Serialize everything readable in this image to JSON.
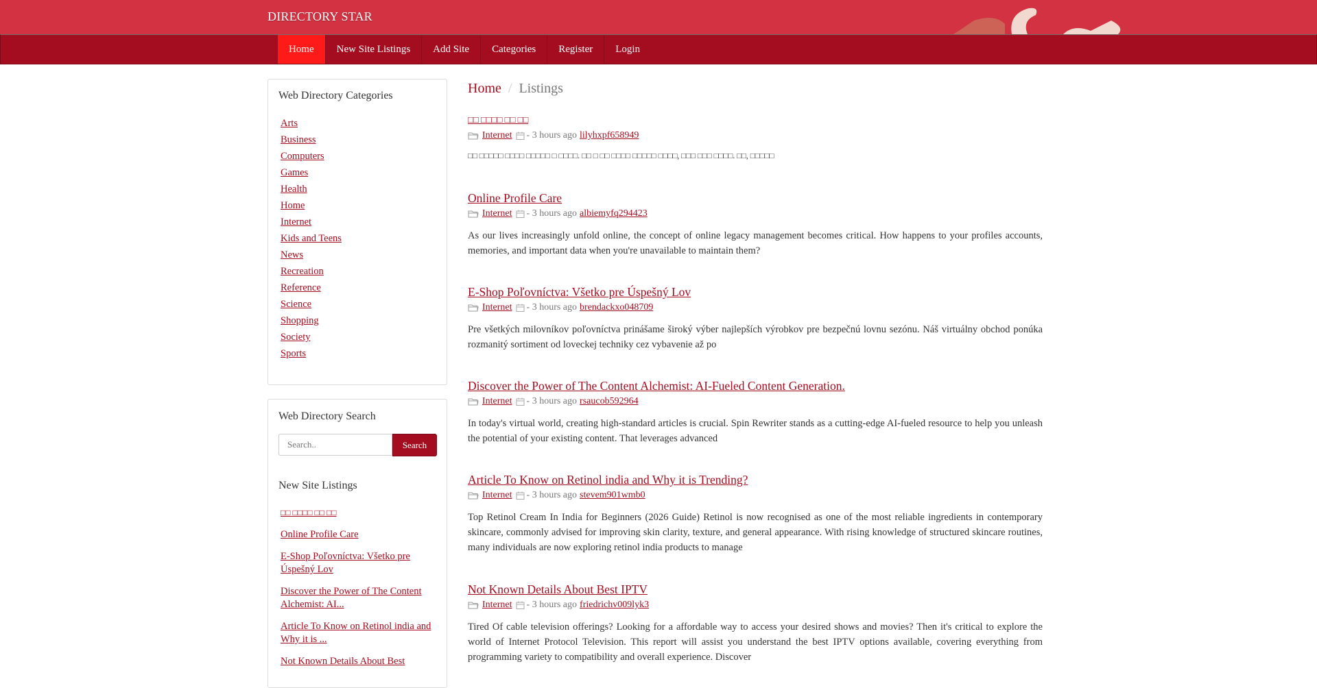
{
  "header": {
    "brand": "DIRECTORY STAR"
  },
  "nav": {
    "items": [
      {
        "label": "Home"
      },
      {
        "label": "New Site Listings"
      },
      {
        "label": "Add Site"
      },
      {
        "label": "Categories"
      },
      {
        "label": "Register"
      },
      {
        "label": "Login"
      }
    ]
  },
  "sidebar": {
    "categories_title": "Web Directory Categories",
    "categories": [
      "Arts",
      "Business",
      "Computers",
      "Games",
      "Health",
      "Home",
      "Internet",
      "Kids and Teens",
      "News",
      "Recreation",
      "Reference",
      "Science",
      "Shopping",
      "Society",
      "Sports"
    ],
    "search_title": "Web Directory Search",
    "search_placeholder": "Search..",
    "search_button": "Search",
    "new_listings_title": "New Site Listings",
    "new_listings": [
      "□□ □□□□ □□ □□",
      "Online Profile Care",
      "E-Shop Poľovníctva: Všetko pre Úspešný Lov",
      "Discover the Power of The Content Alchemist: AI...",
      "Article To Know on Retinol india and Why it is ...",
      "Not Known Details About Best"
    ]
  },
  "breadcrumb": {
    "home": "Home",
    "separator": "/",
    "current": "Listings"
  },
  "listings": [
    {
      "title": "□□ □□□□ □□ □□",
      "category": "Internet",
      "time": "- 3 hours ago",
      "user": "lilyhxpf658949",
      "desc": "□□ □□□□□ □□□□ □□□□□ □ □□□□. □□ □ □□ □□□□ □□□□□ □□□□, □□□ □□□ □□□□. □□, □□□□□"
    },
    {
      "title": "Online Profile Care",
      "category": "Internet",
      "time": "- 3 hours ago",
      "user": "albiemyfq294423",
      "desc": "As our lives increasingly unfold online, the concept of online legacy management becomes critical. How happens to your profiles accounts, memories, and important data when you're unavailable to maintain them?"
    },
    {
      "title": "E-Shop Poľovníctva: Všetko pre Úspešný Lov",
      "category": "Internet",
      "time": "- 3 hours ago",
      "user": "brendackxo048709",
      "desc": "Pre všetkých milovníkov poľovníctva prinášame široký výber najlepších výrobkov pre bezpečnú lovnu sezónu. Náš virtuálny obchod ponúka rozmanitý sortiment od loveckej techniky cez vybavenie až po"
    },
    {
      "title": "Discover the Power of The Content Alchemist: AI-Fueled Content Generation.",
      "category": "Internet",
      "time": "- 3 hours ago",
      "user": "rsaucob592964",
      "desc": "In today's virtual world, creating high-standard articles is crucial. Spin Rewriter stands as a cutting-edge AI-fueled resource to help you unleash the potential of your existing content. That leverages advanced"
    },
    {
      "title": "Article To Know on Retinol india and Why it is Trending?",
      "category": "Internet",
      "time": "- 3 hours ago",
      "user": "stevem901wmb0",
      "desc": "Top Retinol Cream In India for Beginners (2026 Guide) Retinol is now recognised as one of the most reliable ingredients in contemporary skincare, commonly advised for improving skin clarity, texture, and general appearance. With rising knowledge of structured skincare routines, many individuals are now exploring retinol india products to manage"
    },
    {
      "title": "Not Known Details About Best IPTV",
      "category": "Internet",
      "time": "- 3 hours ago",
      "user": "friedrichv009lyk3",
      "desc": "Tired Of cable television offerings? Looking for a affordable way to access your desired shows and movies? Then it's critical to explore the world of Internet Protocol Television. This report will assist you understand the best IPTV options available, covering everything from programming variety to compatibility and overall experience. Discover"
    }
  ]
}
